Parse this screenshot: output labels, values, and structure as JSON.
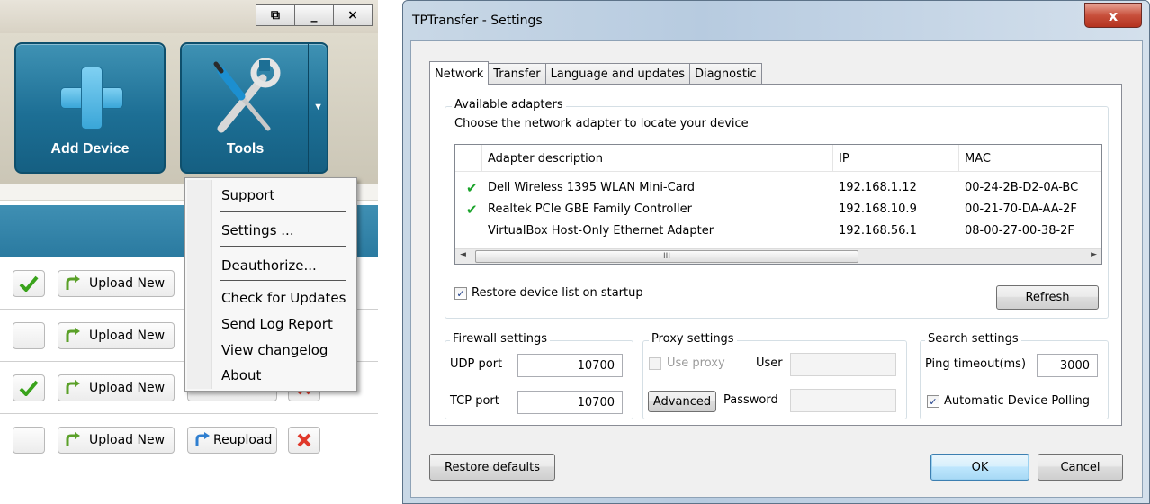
{
  "left_app": {
    "window_buttons": [
      "⧉",
      "_",
      "×"
    ],
    "add_device_label": "Add Device",
    "tools_label": "Tools",
    "tools_menu": {
      "items": [
        "Support",
        "Settings ...",
        "Deauthorize...",
        "Check for Updates",
        "Send Log Report",
        "View changelog",
        "About"
      ]
    },
    "rows": [
      {
        "checked": true,
        "upload_label": "Upload New",
        "reupload_label": "",
        "has_delete": false
      },
      {
        "checked": false,
        "upload_label": "Upload New",
        "reupload_label": "",
        "has_delete": false
      },
      {
        "checked": true,
        "upload_label": "Upload New",
        "reupload_label": "",
        "has_delete": true
      },
      {
        "checked": false,
        "upload_label": "Upload New",
        "reupload_label": "Reupload",
        "has_delete": true
      }
    ]
  },
  "dialog": {
    "title": "TPTransfer - Settings",
    "close_label": "x",
    "tabs": [
      "Network",
      "Transfer",
      "Language and updates",
      "Diagnostic"
    ],
    "active_tab": "Network",
    "adapters": {
      "group_title": "Available adapters",
      "description": "Choose the network adapter to locate your device",
      "columns": [
        "Adapter description",
        "IP",
        "MAC"
      ],
      "rows": [
        {
          "checked": true,
          "description": "Dell Wireless 1395 WLAN Mini-Card",
          "ip": "192.168.1.12",
          "mac": "00-24-2B-D2-0A-BC"
        },
        {
          "checked": true,
          "description": "Realtek PCIe GBE Family Controller",
          "ip": "192.168.10.9",
          "mac": "00-21-70-DA-AA-2F"
        },
        {
          "checked": false,
          "description": "VirtualBox Host-Only Ethernet Adapter",
          "ip": "192.168.56.1",
          "mac": "08-00-27-00-38-2F"
        }
      ],
      "scroll_thumb": "III",
      "restore_label": "Restore device list on startup",
      "restore_checked": true,
      "refresh_label": "Refresh"
    },
    "firewall": {
      "title": "Firewall settings",
      "udp_label": "UDP port",
      "udp_value": "10700",
      "tcp_label": "TCP port",
      "tcp_value": "10700"
    },
    "proxy": {
      "title": "Proxy settings",
      "use_proxy_label": "Use proxy",
      "use_proxy_checked": false,
      "user_label": "User",
      "user_value": "",
      "advanced_label": "Advanced",
      "password_label": "Password",
      "password_value": ""
    },
    "search": {
      "title": "Search settings",
      "ping_label": "Ping timeout(ms)",
      "ping_value": "3000",
      "polling_label": "Automatic Device Polling",
      "polling_checked": true
    },
    "restore_defaults_label": "Restore defaults",
    "ok_label": "OK",
    "cancel_label": "Cancel"
  },
  "colors": {
    "tile_blue": "#1d6f95",
    "dialog_frame": "#b7cbe0",
    "close_red": "#c8503c",
    "check_green": "#1aa32a"
  }
}
